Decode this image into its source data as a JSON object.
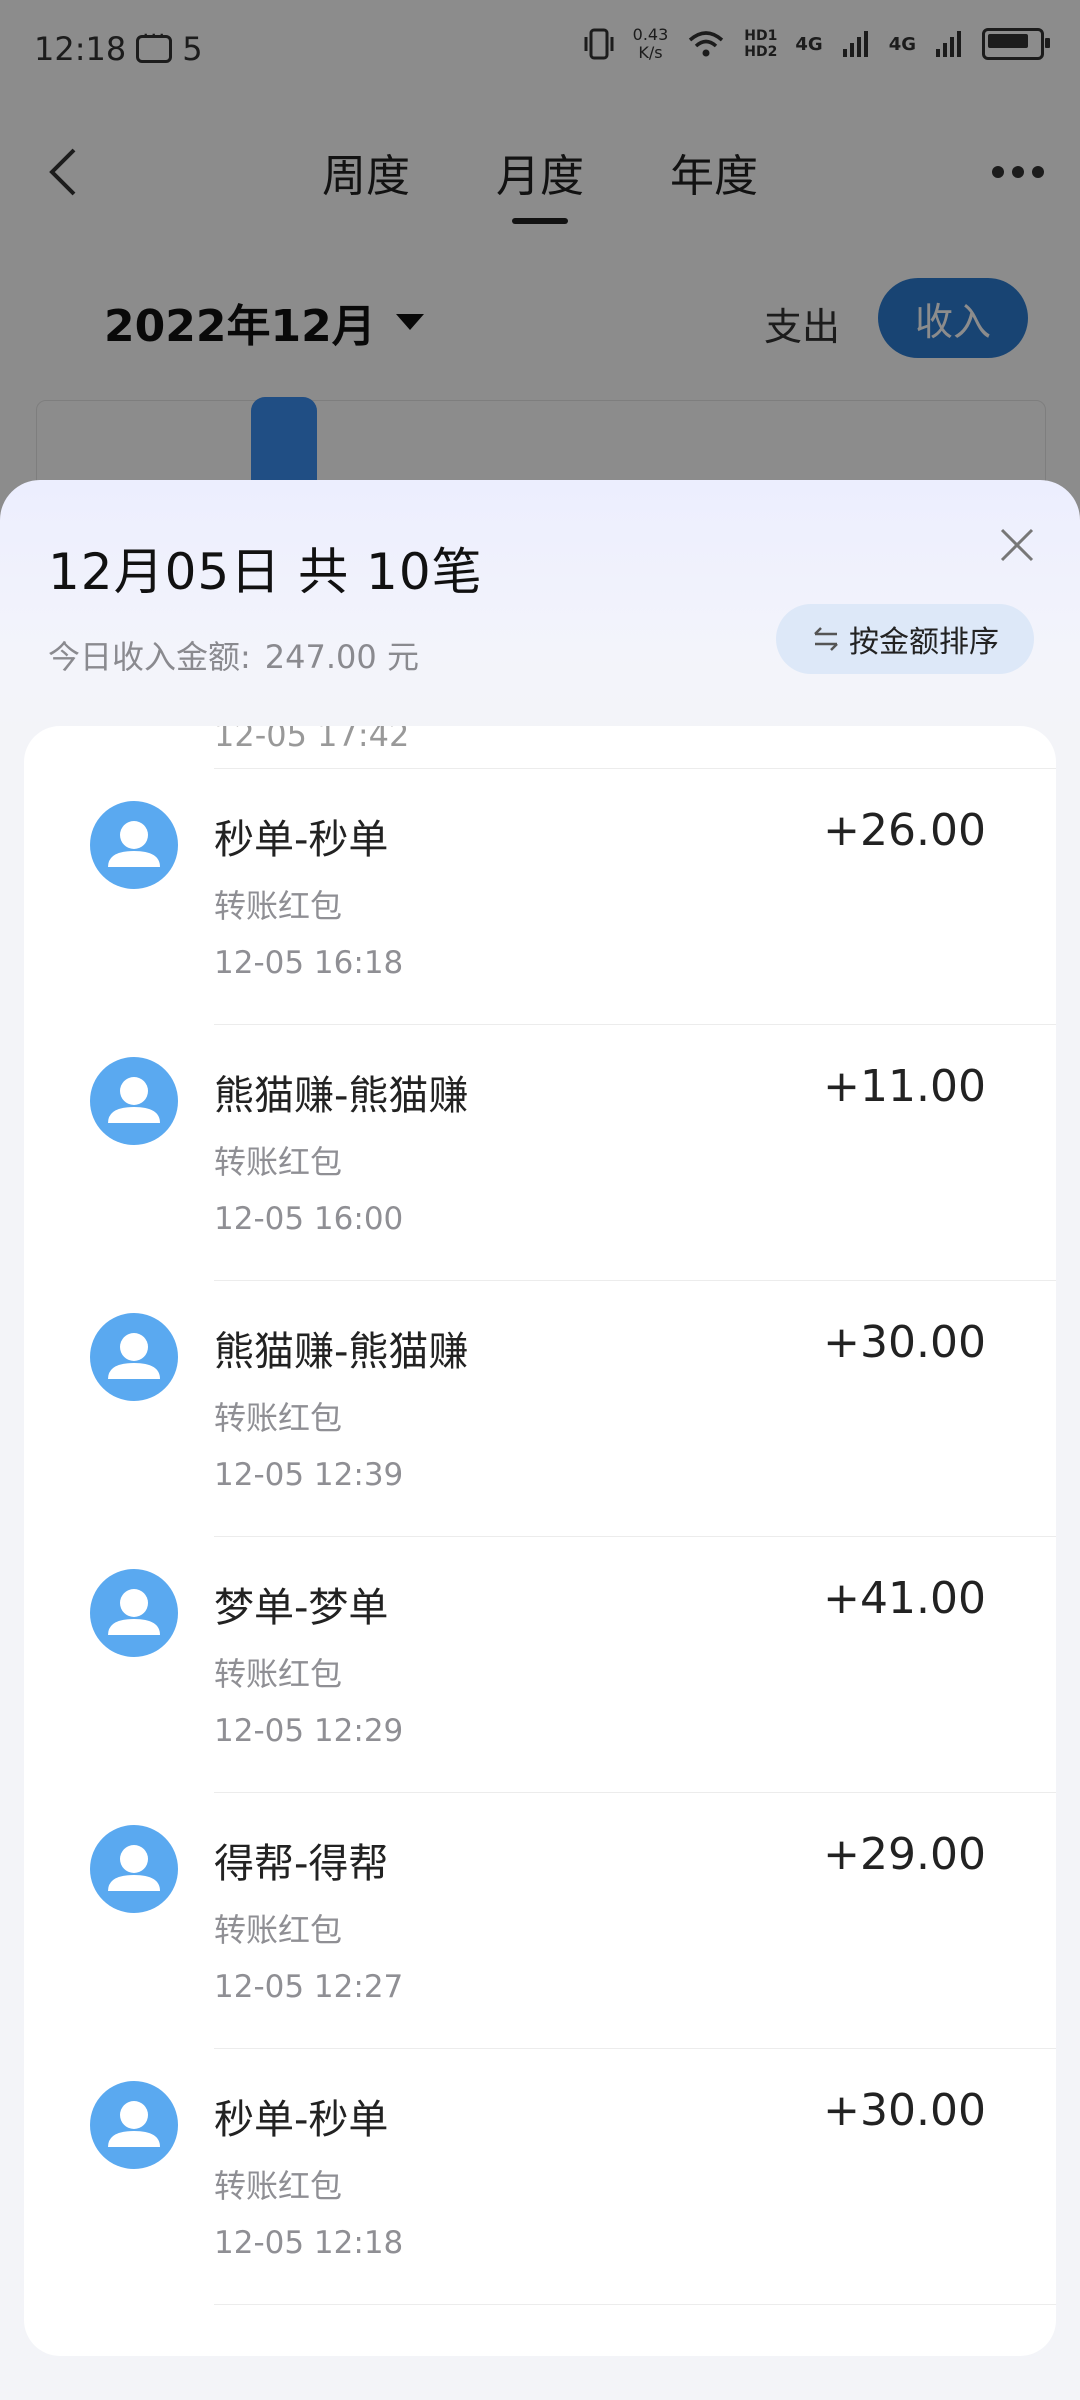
{
  "status": {
    "time": "12:18",
    "notif_count": "5",
    "speed_value": "0.43",
    "speed_unit": "K/s",
    "hd1": "HD1",
    "hd2": "HD2",
    "net1": "4G",
    "net2": "4G"
  },
  "nav": {
    "tabs": [
      {
        "label": "周度"
      },
      {
        "label": "月度"
      },
      {
        "label": "年度"
      }
    ]
  },
  "filter": {
    "month": "2022年12月",
    "expense": "支出",
    "income": "收入"
  },
  "sheet": {
    "title": "12月05日 共 10笔",
    "subtitle_label": "今日收入金额:",
    "subtitle_amount": "247.00 元",
    "sort_label": "按金额排序",
    "partial_time": "12-05 17:42"
  },
  "transactions": [
    {
      "title": "秒单-秒单",
      "type": "转账红包",
      "time": "12-05 16:18",
      "amount": "+26.00"
    },
    {
      "title": "熊猫赚-熊猫赚",
      "type": "转账红包",
      "time": "12-05 16:00",
      "amount": "+11.00"
    },
    {
      "title": "熊猫赚-熊猫赚",
      "type": "转账红包",
      "time": "12-05 12:39",
      "amount": "+30.00"
    },
    {
      "title": "梦单-梦单",
      "type": "转账红包",
      "time": "12-05 12:29",
      "amount": "+41.00"
    },
    {
      "title": "得帮-得帮",
      "type": "转账红包",
      "time": "12-05 12:27",
      "amount": "+29.00"
    },
    {
      "title": "秒单-秒单",
      "type": "转账红包",
      "time": "12-05 12:18",
      "amount": "+30.00"
    }
  ],
  "colors": {
    "accent": "#2d7dd2",
    "avatar": "#5aa9f0",
    "sort_bg": "#dde8f8"
  }
}
